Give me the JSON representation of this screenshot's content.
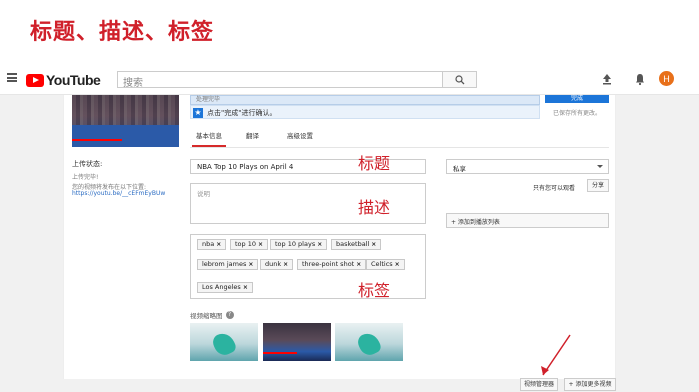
{
  "slide": {
    "title": "标题、描述、标签"
  },
  "header": {
    "app_name": "YouTube",
    "search_placeholder": "搜索",
    "avatar_letter": "H"
  },
  "left": {
    "upload_status_label": "上传状态:",
    "upload_status_text": "上传完毕!",
    "link_label": "您的视频将发布在以下位置:",
    "link_url": "https://youtu.be/__cEFmEyBUw"
  },
  "banner": {
    "progress_text": "处理完毕",
    "publish_label": "完成",
    "confirm_text": "点击\"完成\"进行确认。",
    "saved_text": "已保存所有更改。"
  },
  "tabs": [
    {
      "label": "基本信息"
    },
    {
      "label": "翻译"
    },
    {
      "label": "高级设置"
    }
  ],
  "form": {
    "title_value": "NBA Top 10 Plays on April 4",
    "description_placeholder": "说明",
    "tags": [
      "nba",
      "top 10",
      "top 10 plays",
      "basketball",
      "lebrom james",
      "dunk",
      "three-point shot",
      "Celtics",
      "Los Angeles"
    ]
  },
  "sidebar": {
    "privacy_value": "私享",
    "share_label": "只有您可以观看",
    "share_button": "分享",
    "playlist_button": "+ 添加到播放列表"
  },
  "annotations": {
    "title": "标题",
    "description": "描述",
    "tags": "标签"
  },
  "thumbnails": {
    "label": "视频缩略图"
  },
  "footer": {
    "manager_button": "视频管理器",
    "add_more_button": "+ 添加更多视频"
  },
  "colors": {
    "accent_red": "#d0202a",
    "youtube_red": "#ff0000",
    "link_blue": "#2a6bc2",
    "primary_blue": "#1c75d8"
  }
}
